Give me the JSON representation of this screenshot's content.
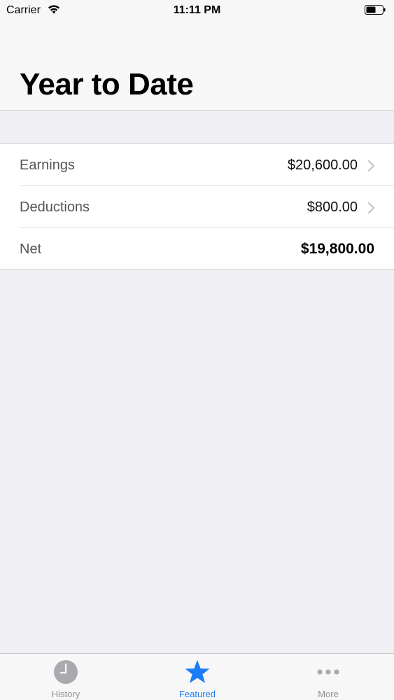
{
  "status_bar": {
    "carrier": "Carrier",
    "time": "11:11 PM",
    "wifi_icon": "wifi-icon",
    "battery_icon": "battery-icon"
  },
  "nav": {
    "title": "Year to Date"
  },
  "rows": [
    {
      "label": "Earnings",
      "value": "$20,600.00",
      "has_chevron": true
    },
    {
      "label": "Deductions",
      "value": "$800.00",
      "has_chevron": true
    },
    {
      "label": "Net",
      "value": "$19,800.00",
      "has_chevron": false
    }
  ],
  "tab_bar": {
    "tabs": [
      {
        "label": "History",
        "icon": "clock-icon",
        "active": false
      },
      {
        "label": "Featured",
        "icon": "star-icon",
        "active": true
      },
      {
        "label": "More",
        "icon": "more-icon",
        "active": false
      }
    ]
  },
  "colors": {
    "accent": "#1a7cf6",
    "inactive": "#8e8e93",
    "background": "#efeff4"
  }
}
